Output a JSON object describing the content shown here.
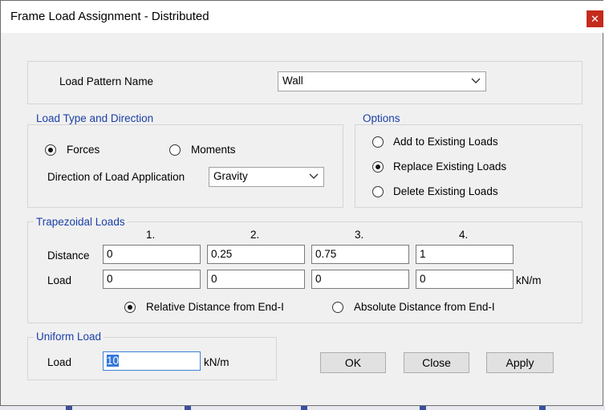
{
  "window": {
    "title": "Frame Load Assignment - Distributed",
    "close_glyph": "✕"
  },
  "load_pattern": {
    "label": "Load Pattern Name",
    "value": "Wall"
  },
  "load_type": {
    "legend": "Load Type and Direction",
    "forces_label": "Forces",
    "moments_label": "Moments",
    "direction_label": "Direction of Load Application",
    "direction_value": "Gravity",
    "selected": "Forces"
  },
  "options": {
    "legend": "Options",
    "add_label": "Add to Existing Loads",
    "replace_label": "Replace Existing Loads",
    "delete_label": "Delete Existing Loads",
    "selected": "Replace Existing Loads"
  },
  "trapezoidal": {
    "legend": "Trapezoidal Loads",
    "columns": [
      "1.",
      "2.",
      "3.",
      "4."
    ],
    "distance_label": "Distance",
    "load_label": "Load",
    "distances": [
      "0",
      "0.25",
      "0.75",
      "1"
    ],
    "loads": [
      "0",
      "0",
      "0",
      "0"
    ],
    "unit": "kN/m",
    "relative_label": "Relative Distance from End-I",
    "absolute_label": "Absolute Distance from End-I",
    "selected": "Relative Distance from End-I"
  },
  "uniform": {
    "legend": "Uniform Load",
    "load_label": "Load",
    "value": "10",
    "unit": "kN/m"
  },
  "buttons": {
    "ok": "OK",
    "close": "Close",
    "apply": "Apply"
  },
  "colors": {
    "accent": "#1a3fa8",
    "close_red": "#c42b1c",
    "focus": "#3c7fd9"
  }
}
